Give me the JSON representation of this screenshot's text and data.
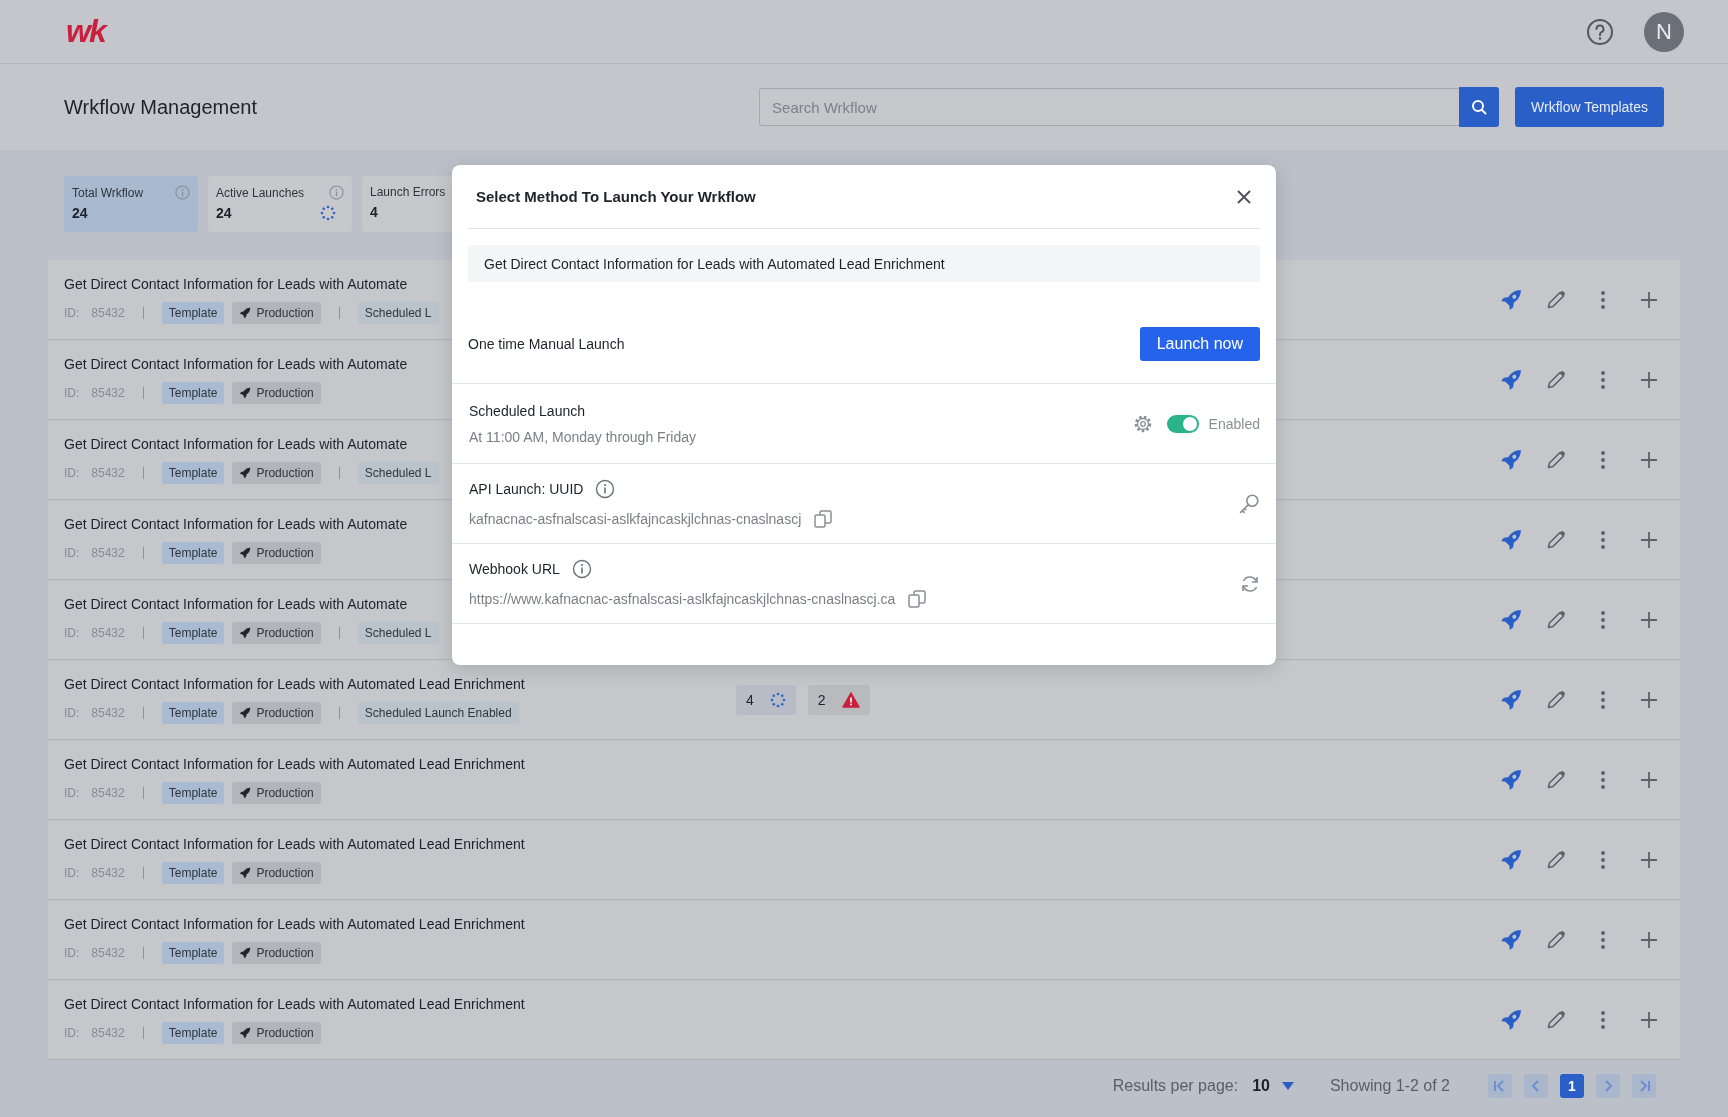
{
  "header": {
    "logo": "wk",
    "avatar": "N"
  },
  "page": {
    "title": "Wrkflow Management",
    "search": {
      "placeholder": "Search Wrkflow"
    },
    "templates_button": "Wrkflow Templates"
  },
  "stats": [
    {
      "label": "Total Wrkflow",
      "value": "24",
      "selected": true,
      "info": true,
      "loading": false
    },
    {
      "label": "Active Launches",
      "value": "24",
      "selected": false,
      "info": true,
      "loading": true
    },
    {
      "label": "Launch Errors",
      "value": "4",
      "selected": false,
      "info": false,
      "loading": false
    }
  ],
  "rows": [
    {
      "title": "Get Direct Contact Information for Leads with Automate",
      "id_label": "ID:",
      "id": "85432",
      "tags": [
        {
          "label": "Template",
          "kind": "template"
        },
        {
          "label": "Production",
          "kind": "production"
        },
        {
          "label": "Scheduled L",
          "kind": "scheduled"
        }
      ],
      "counts": []
    },
    {
      "title": "Get Direct Contact Information for Leads with Automate",
      "id_label": "ID:",
      "id": "85432",
      "tags": [
        {
          "label": "Template",
          "kind": "template"
        },
        {
          "label": "Production",
          "kind": "production"
        }
      ],
      "counts": []
    },
    {
      "title": "Get Direct Contact Information for Leads with Automate",
      "id_label": "ID:",
      "id": "85432",
      "tags": [
        {
          "label": "Template",
          "kind": "template"
        },
        {
          "label": "Production",
          "kind": "production"
        },
        {
          "label": "Scheduled L",
          "kind": "scheduled"
        }
      ],
      "counts": []
    },
    {
      "title": "Get Direct Contact Information for Leads with Automate",
      "id_label": "ID:",
      "id": "85432",
      "tags": [
        {
          "label": "Template",
          "kind": "template"
        },
        {
          "label": "Production",
          "kind": "production"
        }
      ],
      "counts": []
    },
    {
      "title": "Get Direct Contact Information for Leads with Automate",
      "id_label": "ID:",
      "id": "85432",
      "tags": [
        {
          "label": "Template",
          "kind": "template"
        },
        {
          "label": "Production",
          "kind": "production"
        },
        {
          "label": "Scheduled L",
          "kind": "scheduled"
        }
      ],
      "counts": []
    },
    {
      "title": "Get Direct Contact Information for Leads with Automated Lead Enrichment",
      "id_label": "ID:",
      "id": "85432",
      "tags": [
        {
          "label": "Template",
          "kind": "template"
        },
        {
          "label": "Production",
          "kind": "production"
        },
        {
          "label": "Scheduled Launch Enabled",
          "kind": "scheduled"
        }
      ],
      "counts": [
        {
          "value": "4",
          "kind": "running"
        },
        {
          "value": "2",
          "kind": "error"
        }
      ]
    },
    {
      "title": "Get Direct Contact Information for Leads with Automated Lead Enrichment",
      "id_label": "ID:",
      "id": "85432",
      "tags": [
        {
          "label": "Template",
          "kind": "template"
        },
        {
          "label": "Production",
          "kind": "production"
        }
      ],
      "counts": []
    },
    {
      "title": "Get Direct Contact Information for Leads with Automated Lead Enrichment",
      "id_label": "ID:",
      "id": "85432",
      "tags": [
        {
          "label": "Template",
          "kind": "template"
        },
        {
          "label": "Production",
          "kind": "production"
        }
      ],
      "counts": []
    },
    {
      "title": "Get Direct Contact Information for Leads with Automated Lead Enrichment",
      "id_label": "ID:",
      "id": "85432",
      "tags": [
        {
          "label": "Template",
          "kind": "template"
        },
        {
          "label": "Production",
          "kind": "production"
        }
      ],
      "counts": []
    },
    {
      "title": "Get Direct Contact Information for Leads with Automated Lead Enrichment",
      "id_label": "ID:",
      "id": "85432",
      "tags": [
        {
          "label": "Template",
          "kind": "template"
        },
        {
          "label": "Production",
          "kind": "production"
        }
      ],
      "counts": []
    }
  ],
  "pagination": {
    "label": "Results per page:",
    "per_page": "10",
    "summary": "Showing 1-2 of 2",
    "pages": [
      {
        "label": "1",
        "selected": true
      }
    ]
  },
  "modal": {
    "title": "Select Method To Launch Your Wrkflow",
    "workflow_name": "Get Direct Contact Information for Leads with Automated Lead Enrichment",
    "manual": {
      "label": "One time Manual Launch",
      "button": "Launch now"
    },
    "scheduled": {
      "label": "Scheduled Launch",
      "detail": "At 11:00 AM, Monday through Friday",
      "enabled": true,
      "status": "Enabled"
    },
    "api": {
      "label": "API Launch: UUID",
      "value": "kafnacnac-asfnalscasi-aslkfajncaskjlchnas-cnaslnascj"
    },
    "webhook": {
      "label": "Webhook URL",
      "value": "https://www.kafnacnac-asfnalscasi-aslkfajncaskjlchnas-cnaslnascj.ca"
    }
  }
}
